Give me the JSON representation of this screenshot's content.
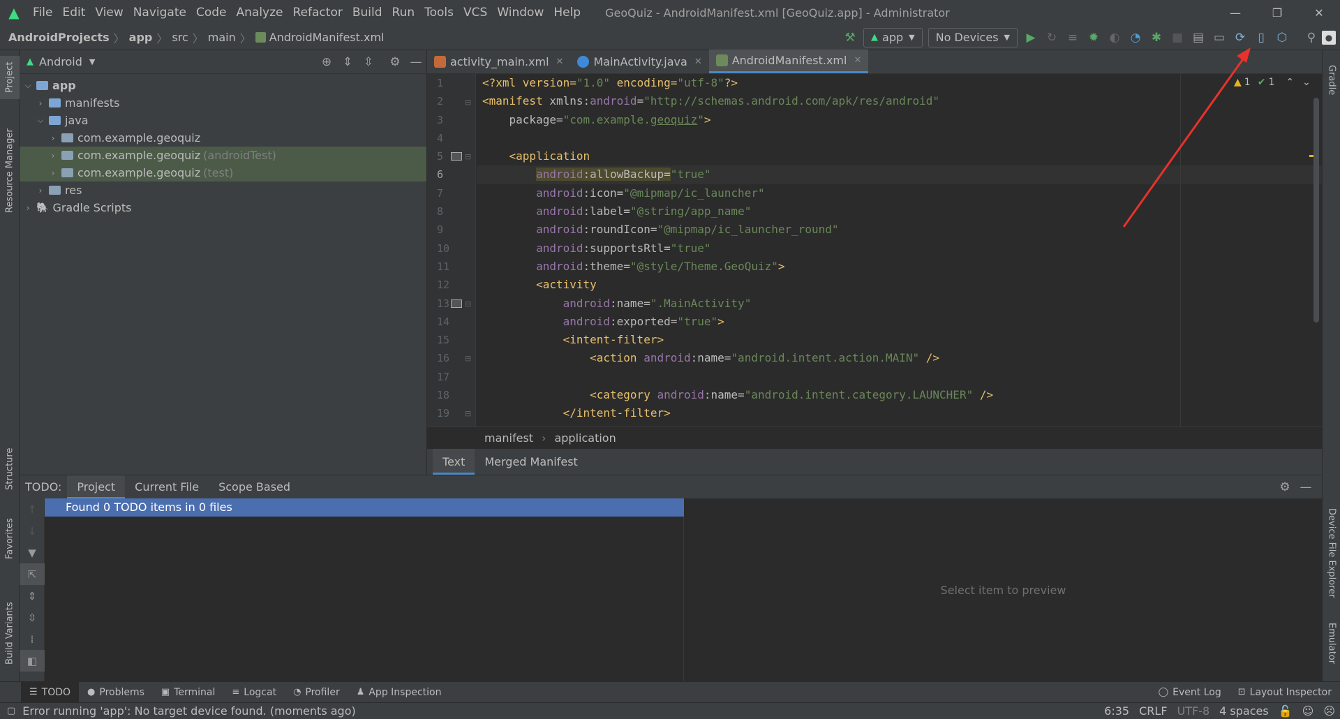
{
  "titlebar": {
    "menu": [
      "File",
      "Edit",
      "View",
      "Navigate",
      "Code",
      "Analyze",
      "Refactor",
      "Build",
      "Run",
      "Tools",
      "VCS",
      "Window",
      "Help"
    ],
    "window_title": "GeoQuiz - AndroidManifest.xml [GeoQuiz.app] - Administrator"
  },
  "breadcrumb": [
    "AndroidProjects",
    "app",
    "src",
    "main",
    "AndroidManifest.xml"
  ],
  "toolbar": {
    "config": "app",
    "device": "No Devices"
  },
  "project": {
    "view_label": "Android",
    "tree": [
      {
        "label": "app",
        "sub": ""
      },
      {
        "label": "manifests",
        "sub": ""
      },
      {
        "label": "java",
        "sub": ""
      },
      {
        "label": "com.example.geoquiz",
        "sub": ""
      },
      {
        "label": "com.example.geoquiz",
        "sub": "(androidTest)"
      },
      {
        "label": "com.example.geoquiz",
        "sub": "(test)"
      },
      {
        "label": "res",
        "sub": ""
      },
      {
        "label": "Gradle Scripts",
        "sub": ""
      }
    ]
  },
  "side_tabs": {
    "left": [
      "Project",
      "Resource Manager",
      "Structure",
      "Favorites",
      "Build Variants"
    ],
    "right": [
      "Gradle",
      "Device File Explorer",
      "Emulator"
    ]
  },
  "editor": {
    "tabs": [
      "activity_main.xml",
      "MainActivity.java",
      "AndroidManifest.xml"
    ],
    "active_tab": "AndroidManifest.xml",
    "line_numbers": [
      "1",
      "2",
      "3",
      "4",
      "5",
      "6",
      "7",
      "8",
      "9",
      "10",
      "11",
      "12",
      "13",
      "14",
      "15",
      "16",
      "17",
      "18",
      "19"
    ],
    "current_line": "6",
    "warnings": "1",
    "checks": "1",
    "breadcrumb": [
      "manifest",
      "application"
    ],
    "bottom_tabs": [
      "Text",
      "Merged Manifest"
    ],
    "code": {
      "l1": [
        "<?xml version=",
        "\"1.0\"",
        " encoding=",
        "\"utf-8\"",
        "?>"
      ],
      "l2": [
        "<manifest ",
        "xmlns:",
        "android",
        "=",
        "\"http://schemas.android.com/apk/res/android\""
      ],
      "l3": [
        "    package=",
        "\"com.example.",
        "geoquiz",
        "\"",
        ">"
      ],
      "l5": [
        "    <application"
      ],
      "l6": [
        "        ",
        "android",
        ":allowBackup=",
        "\"true\""
      ],
      "l7": [
        "        ",
        "android",
        ":icon=",
        "\"@mipmap/ic_launcher\""
      ],
      "l8": [
        "        ",
        "android",
        ":label=",
        "\"@string/app_name\""
      ],
      "l9": [
        "        ",
        "android",
        ":roundIcon=",
        "\"@mipmap/ic_launcher_round\""
      ],
      "l10": [
        "        ",
        "android",
        ":supportsRtl=",
        "\"true\""
      ],
      "l11": [
        "        ",
        "android",
        ":theme=",
        "\"@style/Theme.GeoQuiz\"",
        ">"
      ],
      "l12": [
        "        <activity"
      ],
      "l13": [
        "            ",
        "android",
        ":name=",
        "\".MainActivity\""
      ],
      "l14": [
        "            ",
        "android",
        ":exported=",
        "\"true\"",
        ">"
      ],
      "l15": [
        "            <intent-filter>"
      ],
      "l16": [
        "                <action ",
        "android",
        ":name=",
        "\"android.intent.action.MAIN\"",
        " />"
      ],
      "l18": [
        "                <category ",
        "android",
        ":name=",
        "\"android.intent.category.LAUNCHER\"",
        " />"
      ],
      "l19": [
        "            </intent-filter>"
      ]
    }
  },
  "todo": {
    "label": "TODO:",
    "tabs": [
      "Project",
      "Current File",
      "Scope Based"
    ],
    "result": "Found 0 TODO items in 0 files",
    "preview": "Select item to preview"
  },
  "tool_windows": {
    "left": [
      "TODO",
      "Problems",
      "Terminal",
      "Logcat",
      "Profiler",
      "App Inspection"
    ],
    "right": [
      "Event Log",
      "Layout Inspector"
    ]
  },
  "status": {
    "message": "Error running 'app': No target device found. (moments ago)",
    "position": "6:35",
    "line_sep": "CRLF",
    "encoding": "UTF-8",
    "indent": "4 spaces"
  },
  "colors": {
    "accent": "#4a88c7",
    "android_green": "#3ddc84",
    "annotation_arrow": "#e8322b"
  }
}
